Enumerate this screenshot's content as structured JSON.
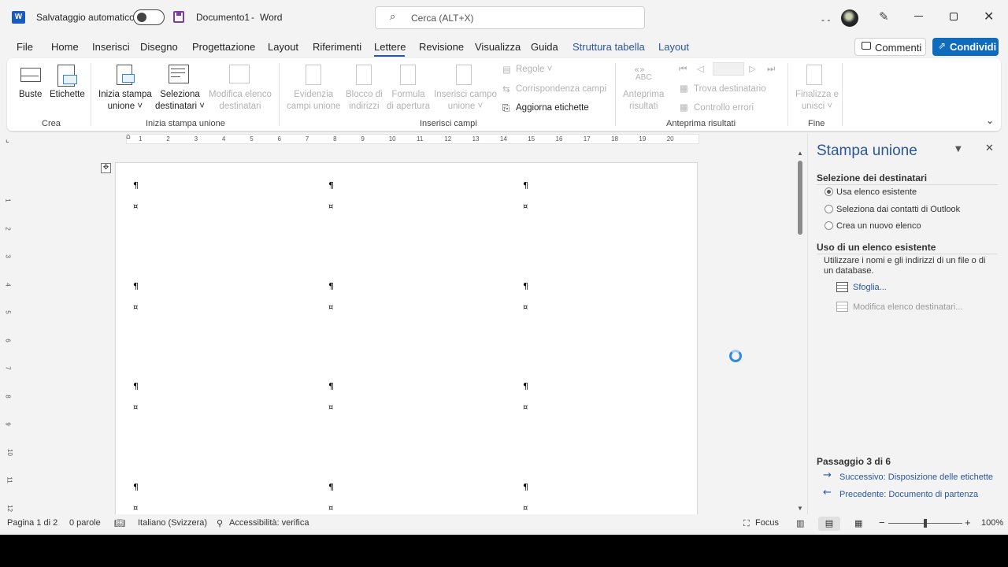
{
  "titlebar": {
    "autosave_label": "Salvataggio automatico",
    "document_title": "Documento1",
    "separator": "-",
    "app_name": "Word",
    "search_placeholder": "Cerca (ALT+X)",
    "dashes": "- -"
  },
  "menu": {
    "file": "File",
    "home": "Home",
    "insert": "Inserisci",
    "draw": "Disegno",
    "design": "Progettazione",
    "layout": "Layout",
    "references": "Riferimenti",
    "mailings": "Lettere",
    "review": "Revisione",
    "view": "Visualizza",
    "help": "Guida",
    "table_design": "Struttura tabella",
    "table_layout": "Layout",
    "comments": "Commenti",
    "share": "Condividi"
  },
  "ribbon": {
    "envelopes": "Buste",
    "labels": "Etichette",
    "group_create": "Crea",
    "start_merge_1": "Inizia stampa",
    "start_merge_2": "unione",
    "select_recipients_1": "Seleziona",
    "select_recipients_2": "destinatari",
    "edit_list_1": "Modifica elenco",
    "edit_list_2": "destinatari",
    "group_start": "Inizia stampa unione",
    "highlight_1": "Evidenzia",
    "highlight_2": "campi unione",
    "address_block_1": "Blocco di",
    "address_block_2": "indirizzi",
    "greeting_1": "Formula",
    "greeting_2": "di apertura",
    "insert_field_1": "Inserisci campo",
    "insert_field_2": "unione",
    "rules": "Regole",
    "match_fields": "Corrispondenza campi",
    "update_labels": "Aggiorna etichette",
    "group_fields": "Inserisci campi",
    "abc": "ABC",
    "preview_1": "Anteprima",
    "preview_2": "risultati",
    "find_recipient": "Trova destinatario",
    "check_errors": "Controllo errori",
    "group_preview": "Anteprima risultati",
    "finish_1": "Finalizza e",
    "finish_2": "unisci",
    "group_finish": "Fine"
  },
  "ruler": {
    "ticks": [
      "1",
      "2",
      "3",
      "4",
      "5",
      "6",
      "7",
      "8",
      "9",
      "10",
      "11",
      "12",
      "13",
      "14",
      "15",
      "16",
      "17",
      "18",
      "19",
      "20"
    ],
    "vticks": [
      "1",
      "2",
      "3",
      "4",
      "5",
      "6",
      "7",
      "8",
      "9",
      "10",
      "11",
      "12"
    ]
  },
  "document": {
    "pilcrow": "¶",
    "cell_mark": "¤"
  },
  "pane": {
    "title": "Stampa unione",
    "section1": "Selezione dei destinatari",
    "opt_existing": "Usa elenco esistente",
    "opt_outlook": "Seleziona dai contatti di Outlook",
    "opt_new": "Crea un nuovo elenco",
    "section2": "Uso di un elenco esistente",
    "desc_1": "Utilizzare i nomi e gli indirizzi di un file o di",
    "desc_2": "un database.",
    "browse": "Sfoglia...",
    "edit_list": "Modifica elenco destinatari...",
    "step": "Passaggio 3 di 6",
    "next": "Successivo: Disposizione delle etichette",
    "previous": "Precedente: Documento di partenza"
  },
  "status": {
    "page": "Pagina 1 di 2",
    "words": "0 parole",
    "language": "Italiano (Svizzera)",
    "accessibility": "Accessibilità: verifica",
    "focus": "Focus",
    "zoom_minus": "−",
    "zoom_plus": "+",
    "zoom": "100%"
  },
  "colors": {
    "accent": "#2b579a",
    "share_button": "#0f6cbd",
    "word_icon": "#185abd",
    "save_icon": "#7b3f9e",
    "spinner": "#2d8ae0"
  }
}
